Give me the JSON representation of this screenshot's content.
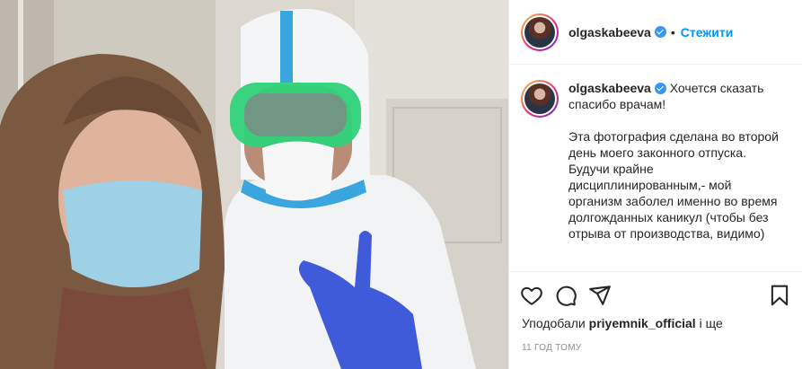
{
  "post": {
    "username": "olgaskabeeva",
    "verified": true,
    "separator": "•",
    "follow_label": "Стежити",
    "caption_title": "Хочется сказать спасибо врачам!",
    "caption_body": "Эта фотография сделана во второй день моего законного отпуска. Будучи крайне дисциплинированным,- мой организм заболел именно во время долгожданных каникул (чтобы без отрыва от производства, видимо)",
    "likes_prefix": "Уподобали",
    "likes_user": "priyemnik_official",
    "likes_suffix": "і ще",
    "time_ago": "11 год тому"
  },
  "icons": {
    "like": "heart-icon",
    "comment": "comment-icon",
    "share": "share-icon",
    "save": "bookmark-icon",
    "verified": "verified-badge-icon"
  },
  "colors": {
    "follow": "#0095f6",
    "verified": "#3897f0",
    "secondary_text": "#8e8e8e",
    "border": "#efefef"
  }
}
